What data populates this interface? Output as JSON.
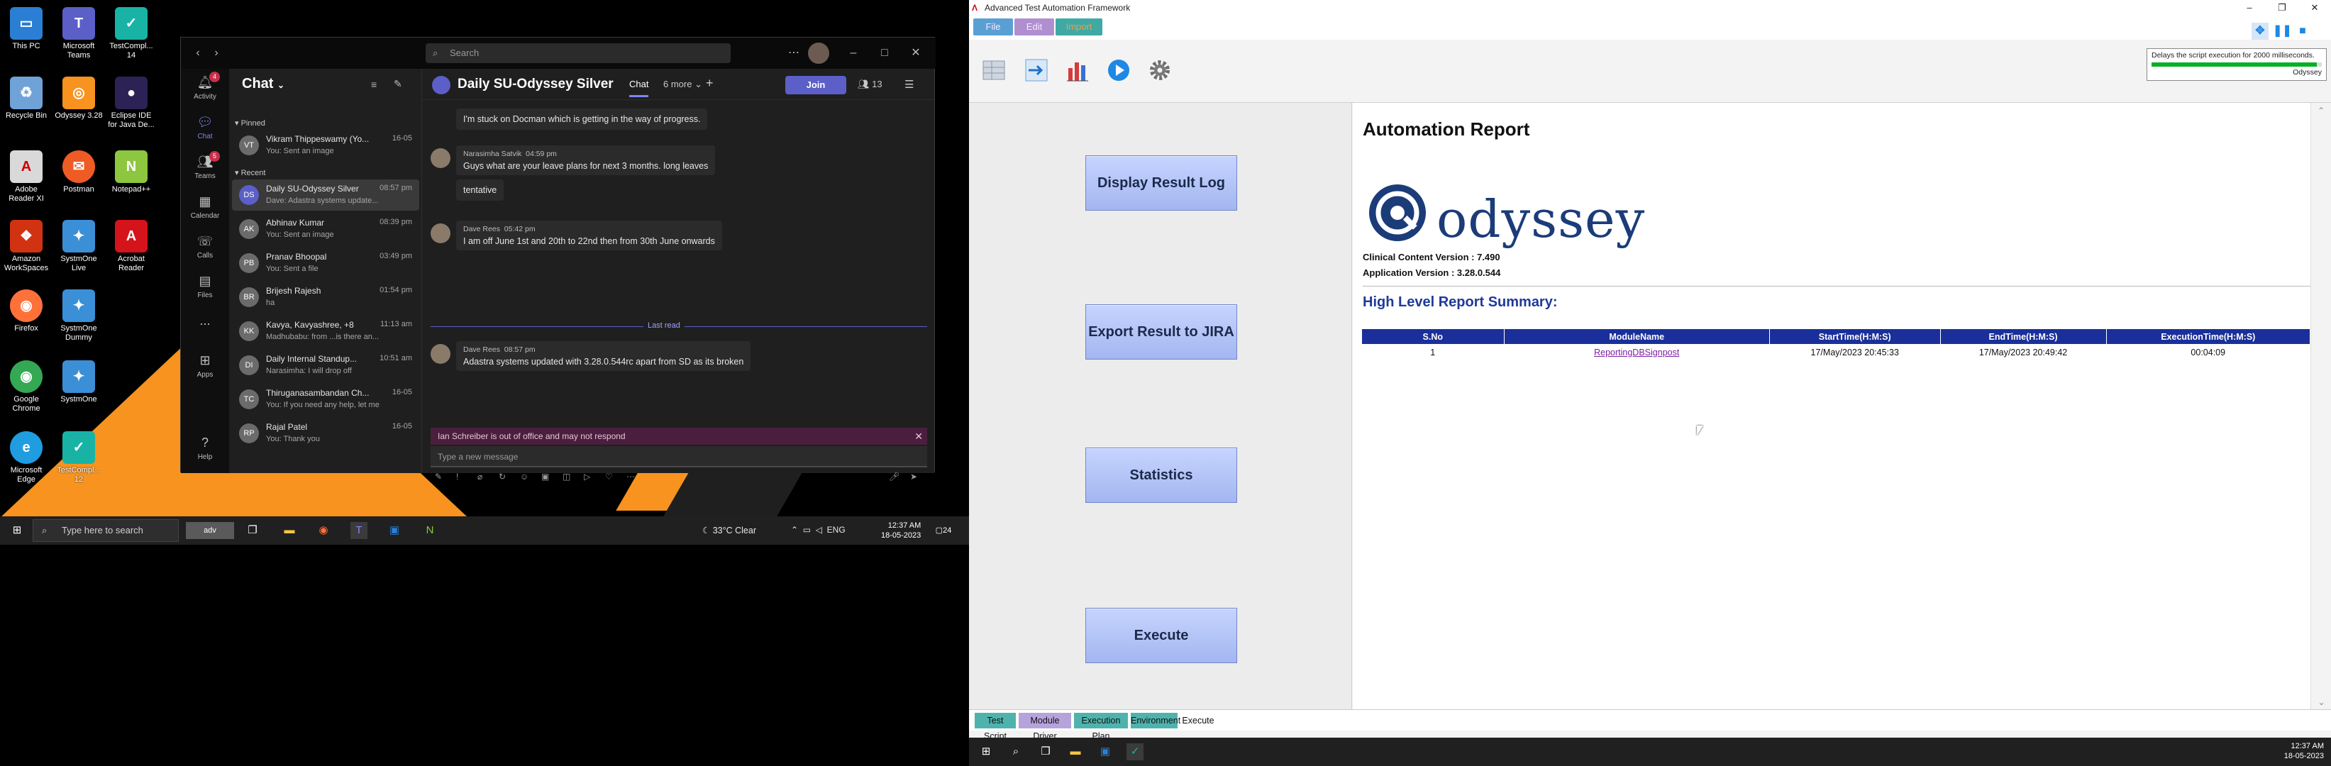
{
  "desktop": {
    "icons": [
      {
        "label": "This PC",
        "icon": "pc-icon",
        "color": "#2a7fd4"
      },
      {
        "label": "Microsoft Teams",
        "icon": "teams-icon",
        "color": "#5b5fc7"
      },
      {
        "label": "TestCompl... 14",
        "icon": "testcomplete-icon",
        "color": "#19b3a6"
      },
      {
        "label": "Recycle Bin",
        "icon": "recycle-bin-icon",
        "color": "#6fa3d8"
      },
      {
        "label": "Odyssey 3.28",
        "icon": "odyssey-icon",
        "color": "#f7931e"
      },
      {
        "label": "Eclipse IDE for Java De...",
        "icon": "eclipse-icon",
        "color": "#2c2255"
      },
      {
        "label": "Adobe Reader XI",
        "icon": "adobe-reader-icon",
        "color": "#d9d9d9"
      },
      {
        "label": "Postman",
        "icon": "postman-icon",
        "color": "#ef5b25"
      },
      {
        "label": "Notepad++",
        "icon": "notepadpp-icon",
        "color": "#8dc63f"
      },
      {
        "label": "Amazon WorkSpaces",
        "icon": "workspaces-icon",
        "color": "#d13212"
      },
      {
        "label": "SystmOne Live",
        "icon": "systmone-live-icon",
        "color": "#3a8fd6"
      },
      {
        "label": "Acrobat Reader",
        "icon": "acrobat-icon",
        "color": "#d4131a"
      },
      {
        "label": "Firefox",
        "icon": "firefox-icon",
        "color": "#ff7139"
      },
      {
        "label": "SystmOne Dummy",
        "icon": "systmone-dummy-icon",
        "color": "#3a8fd6"
      },
      {
        "label": "Google Chrome",
        "icon": "chrome-icon",
        "color": "#34a853"
      },
      {
        "label": "SystmOne",
        "icon": "systmone-icon",
        "color": "#3a8fd6"
      },
      {
        "label": "Microsoft Edge",
        "icon": "edge-icon",
        "color": "#1f9de0"
      },
      {
        "label": "TestCompl... 12",
        "icon": "testcomplete12-icon",
        "color": "#19b3a6"
      }
    ]
  },
  "teams": {
    "search_placeholder": "Search",
    "rail": [
      {
        "label": "Activity",
        "badge": "4"
      },
      {
        "label": "Chat",
        "badge": ""
      },
      {
        "label": "Teams",
        "badge": "5"
      },
      {
        "label": "Calendar",
        "badge": ""
      },
      {
        "label": "Calls",
        "badge": ""
      },
      {
        "label": "Files",
        "badge": ""
      },
      {
        "label": "...",
        "badge": ""
      },
      {
        "label": "Apps",
        "badge": ""
      },
      {
        "label": "Help",
        "badge": ""
      }
    ],
    "list_title": "Chat",
    "pinned_label": "Pinned",
    "recent_label": "Recent",
    "pinned": [
      {
        "initials": "VT",
        "name": "Vikram Thippeswamy (Yo...",
        "preview": "You: Sent an image",
        "time": "16-05"
      }
    ],
    "recent": [
      {
        "initials": "DS",
        "name": "Daily SU-Odyssey Silver",
        "preview": "Dave: Adastra systems update...",
        "time": "08:57 pm",
        "active": true
      },
      {
        "initials": "AK",
        "name": "Abhinav Kumar",
        "preview": "You: Sent an image",
        "time": "08:39 pm"
      },
      {
        "initials": "PB",
        "name": "Pranav Bhoopal",
        "preview": "You: Sent a file",
        "time": "03:49 pm"
      },
      {
        "initials": "BR",
        "name": "Brijesh Rajesh",
        "preview": "ha",
        "time": "01:54 pm"
      },
      {
        "initials": "KK",
        "name": "Kavya, Kavyashree, +8",
        "preview": "Madhubabu: from ...is there an...",
        "time": "11:13 am"
      },
      {
        "initials": "DI",
        "name": "Daily Internal Standup...",
        "preview": "Narasimha: I will drop off",
        "time": "10:51 am"
      },
      {
        "initials": "TC",
        "name": "Thiruganasambandan Ch...",
        "preview": "You: If you need any help, let me ...",
        "time": "16-05"
      },
      {
        "initials": "RP",
        "name": "Rajal Patel",
        "preview": "You: Thank you",
        "time": "16-05"
      }
    ],
    "conversation": {
      "title": "Daily SU-Odyssey Silver",
      "tab_chat": "Chat",
      "tab_more": "6 more",
      "join_label": "Join",
      "participants": "13",
      "messages": [
        {
          "kind": "plain",
          "text": "I'm stuck on Docman which is getting in the way of progress."
        },
        {
          "kind": "msg",
          "author": "Narasimha Satvik",
          "time": "04:59 pm",
          "text": "Guys what are your leave plans for next 3 months. long leaves"
        },
        {
          "kind": "plain",
          "text": "tentative"
        },
        {
          "kind": "msg",
          "author": "Dave Rees",
          "time": "05:42 pm",
          "text": "I am off June 1st and 20th to 22nd then from 30th June onwards"
        },
        {
          "kind": "msg",
          "author": "Dave Rees",
          "time": "08:57 pm",
          "text": "Adastra systems updated with 3.28.0.544rc  apart from SD as its broken"
        }
      ],
      "last_read": "Last read",
      "ooo_banner": "Ian Schreiber is out of office and may not respond",
      "compose_placeholder": "Type a new message"
    }
  },
  "taskbar1": {
    "search_placeholder": "Type here to search",
    "weather": "33°C  Clear",
    "lang": "ENG",
    "time": "12:37 AM",
    "date": "18-05-2023",
    "notifications": "24"
  },
  "ataf": {
    "window_title": "Advanced Test Automation Framework",
    "menu": [
      {
        "label": "File",
        "color": "#5a9fd4"
      },
      {
        "label": "Edit",
        "color": "#b08fd0"
      },
      {
        "label": "Import",
        "color": "#3fa9a4"
      }
    ],
    "delay_tooltip": "Delays the script execution for 2000 milliseconds.",
    "delay_progress": 0.97,
    "delay_label": "Odyssey",
    "buttons": {
      "display_result": "Display Result Log",
      "export_jira": "Export Result to JIRA",
      "statistics": "Statistics",
      "execute": "Execute"
    },
    "report": {
      "title": "Automation Report",
      "logo_word": "odyssey",
      "clinical_version": "Clinical Content Version : 7.490",
      "app_version": "Application Version : 3.28.0.544",
      "summary_title": "High Level Report Summary:",
      "headers": [
        "S.No",
        "ModuleName",
        "StartTime(H:M:S)",
        "EndTime(H:M:S)",
        "ExecutionTime(H:M:S)"
      ],
      "rows": [
        {
          "sno": "1",
          "module": "ReportingDBSignpost",
          "start": "17/May/2023 20:45:33",
          "end": "17/May/2023 20:49:42",
          "exec": "00:04:09"
        }
      ]
    },
    "tabs": [
      {
        "label": "Test Script",
        "color": "#4fb3ad"
      },
      {
        "label": "Module Driver",
        "color": "#b7a3dc"
      },
      {
        "label": "Execution Plan",
        "color": "#4fb3ad"
      },
      {
        "label": "Environment",
        "color": "#4fb3ad"
      },
      {
        "label": "Execute",
        "color": "#ffffff"
      }
    ]
  },
  "taskbar2": {
    "time": "12:37 AM",
    "date": "18-05-2023"
  }
}
